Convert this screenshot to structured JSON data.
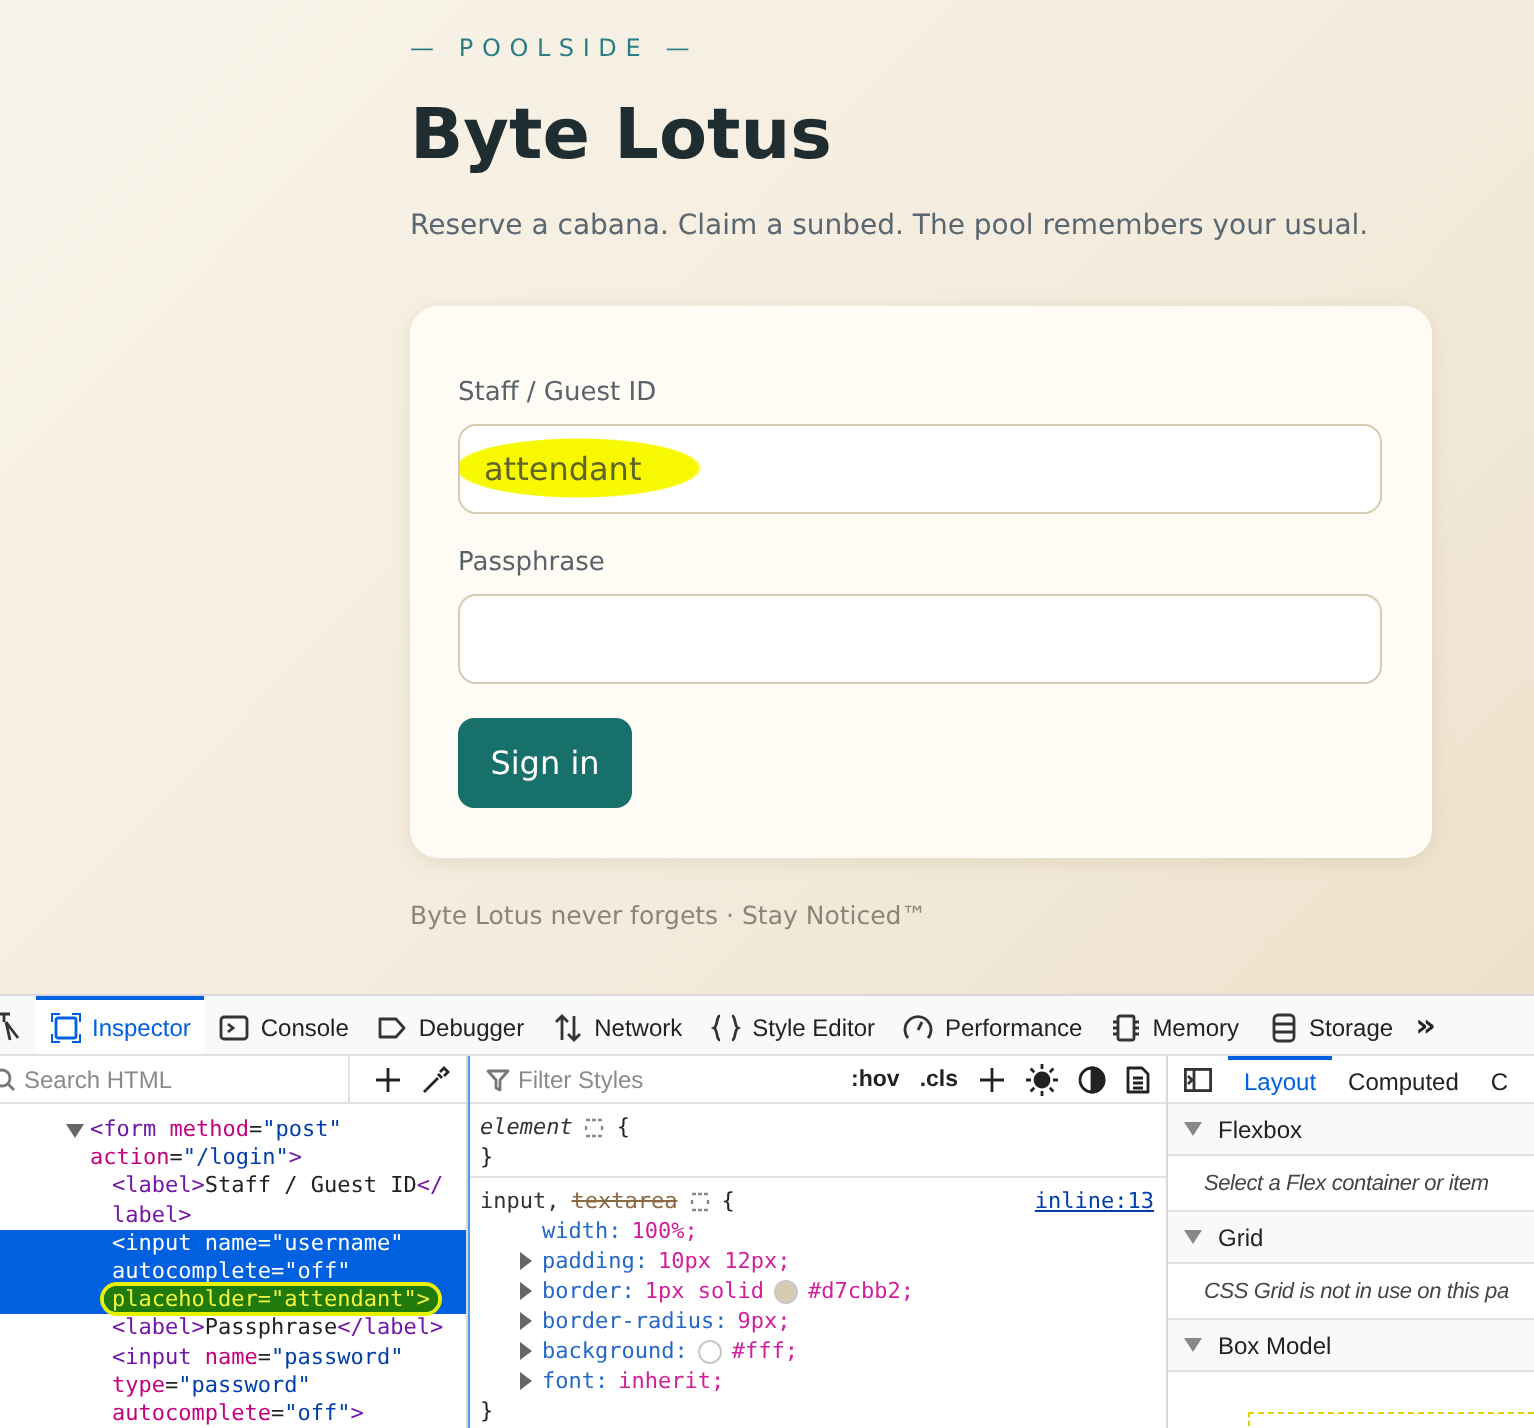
{
  "page": {
    "eyebrow": "— POOLSIDE —",
    "title": "Byte Lotus",
    "subtitle": "Reserve a cabana. Claim a sunbed. The pool remembers your usual.",
    "form": {
      "fields": [
        {
          "label": "Staff / Guest ID",
          "placeholder": "attendant",
          "highlighted": true
        },
        {
          "label": "Passphrase",
          "highlighted": false
        }
      ],
      "submit": "Sign in"
    },
    "footer": "Byte Lotus never forgets · Stay Noticed™"
  },
  "devtools": {
    "tabs": [
      {
        "label": "Inspector",
        "selected": true
      },
      {
        "label": "Console",
        "selected": false
      },
      {
        "label": "Debugger",
        "selected": false
      },
      {
        "label": "Network",
        "selected": false
      },
      {
        "label": "Style Editor",
        "selected": false
      },
      {
        "label": "Performance",
        "selected": false
      },
      {
        "label": "Memory",
        "selected": false
      },
      {
        "label": "Storage",
        "selected": false
      }
    ],
    "overflow": "»",
    "markup": {
      "search_placeholder": "Search HTML",
      "nodes": [
        {
          "expanded": true,
          "selected": false,
          "lines": [
            {
              "text": "<form method=\"post\"",
              "marked": false
            },
            {
              "text": "action=\"/login\">",
              "marked": false
            }
          ],
          "children": [
            {
              "selected": false,
              "lines": [
                {
                  "text": "<label>Staff / Guest ID</",
                  "marked": false
                },
                {
                  "text": "label>",
                  "marked": false
                }
              ]
            },
            {
              "selected": true,
              "lines": [
                {
                  "text": "<input name=\"username\"",
                  "marked": false
                },
                {
                  "text": "autocomplete=\"off\"",
                  "marked": false
                },
                {
                  "text": "placeholder=\"attendant\">",
                  "marked": true
                }
              ]
            },
            {
              "selected": false,
              "lines": [
                {
                  "text": "<label>Passphrase</label>",
                  "marked": false
                }
              ]
            },
            {
              "selected": false,
              "lines": [
                {
                  "text": "<input name=\"password\"",
                  "marked": false
                },
                {
                  "text": "type=\"password\"",
                  "marked": false
                },
                {
                  "text": "autocomplete=\"off\">",
                  "marked": false
                }
              ]
            }
          ]
        }
      ]
    },
    "rules": {
      "filter_placeholder": "Filter Styles",
      "toggles": [
        ":hov",
        ".cls"
      ],
      "rules": [
        {
          "kind": "element",
          "selectors": [
            {
              "text": "element",
              "matched": true
            }
          ],
          "open": "{",
          "close": "}"
        },
        {
          "kind": "rule",
          "selectors": [
            {
              "text": "input,",
              "matched": true
            },
            {
              "text": "textarea",
              "matched": false
            }
          ],
          "source": "inline:13",
          "open": "{",
          "close": "}",
          "props": [
            {
              "name": "width:",
              "value": "100%;",
              "expandable": false
            },
            {
              "name": "padding:",
              "value": "10px 12px;",
              "expandable": true
            },
            {
              "name": "border:",
              "value_before": "1px solid",
              "color": "#d7cbb2",
              "value": "#d7cbb2;",
              "expandable": true
            },
            {
              "name": "border-radius:",
              "value": "9px;",
              "expandable": true
            },
            {
              "name": "background:",
              "color": "#ffffff",
              "value": "#fff;",
              "expandable": true
            },
            {
              "name": "font:",
              "value": "inherit;",
              "expandable": true
            }
          ]
        }
      ]
    },
    "sidebar": {
      "tabs": [
        {
          "label": "Layout",
          "selected": true
        },
        {
          "label": "Computed",
          "selected": false
        },
        {
          "label": "C",
          "selected": false
        }
      ],
      "sections": [
        {
          "title": "Flexbox",
          "expanded": true,
          "note": "Select a Flex container or item"
        },
        {
          "title": "Grid",
          "expanded": true,
          "note": "CSS Grid is not in use on this pa"
        },
        {
          "title": "Box Model",
          "expanded": true
        }
      ]
    }
  }
}
